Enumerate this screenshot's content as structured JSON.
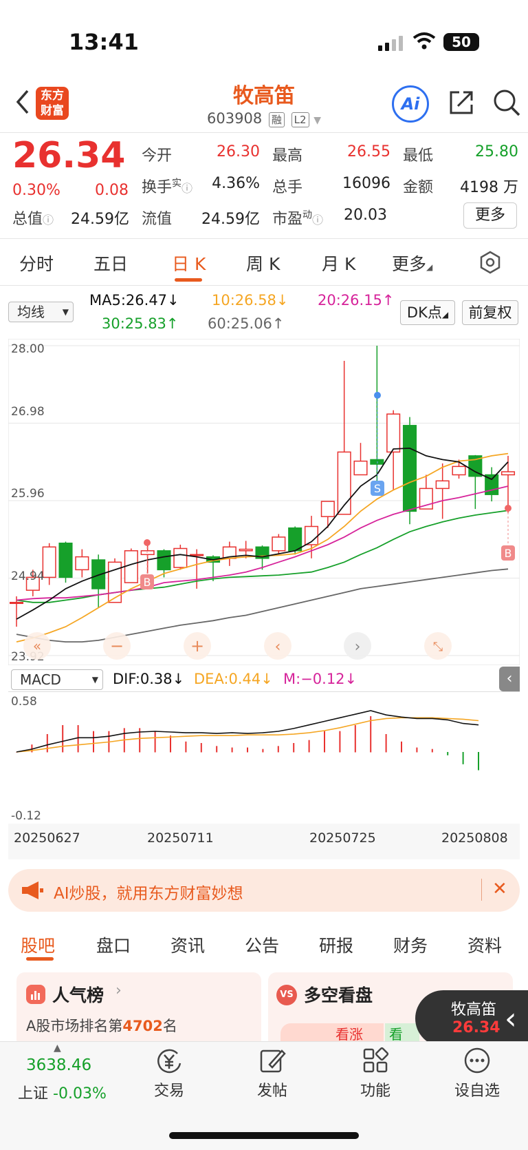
{
  "status": {
    "time": "13:41",
    "battery": "50"
  },
  "header": {
    "logo_line1": "东方",
    "logo_line2": "财富",
    "title": "牧高笛",
    "code": "603908",
    "tag1": "融",
    "tag2": "L2",
    "ai": "Ai"
  },
  "quote": {
    "price": "26.34",
    "pct": "0.30%",
    "change": "0.08",
    "open_label": "今开",
    "open": "26.30",
    "high_label": "最高",
    "high": "26.55",
    "low_label": "最低",
    "low": "25.80",
    "turnover_label": "换手",
    "turnover_sup": "实",
    "turnover": "4.36%",
    "vol_label": "总手",
    "vol": "16096",
    "amount_label": "金额",
    "amount": "4198 万",
    "mcap_label": "总值",
    "mcap": "24.59亿",
    "float_label": "流值",
    "float": "24.59亿",
    "pe_label": "市盈",
    "pe_sup": "动",
    "pe": "20.03",
    "more": "更多"
  },
  "tabs": [
    "分时",
    "五日",
    "日 K",
    "周 K",
    "月 K",
    "更多"
  ],
  "ma": {
    "selector": "均线",
    "ma5": "MA5:26.47↓",
    "ma10": "10:26.58↓",
    "ma20": "20:26.15↑",
    "ma30": "30:25.83↑",
    "ma60": "60:25.06↑",
    "dk": "DK点",
    "fq": "前复权"
  },
  "kchart": {
    "y_labels": [
      "28.00",
      "26.98",
      "25.96",
      "24.94",
      "23.92"
    ],
    "marker_b": "B",
    "marker_s": "S"
  },
  "macd": {
    "selector": "MACD",
    "dif": "DIF:0.38↓",
    "dea": "DEA:0.44↓",
    "m": "M:−0.12↓",
    "y_top": "0.58",
    "y_bottom": "-0.12"
  },
  "dates": [
    "20250627",
    "20250711",
    "20250725",
    "20250808"
  ],
  "banner": {
    "text": "AI炒股，就用东方财富妙想",
    "close": "✕"
  },
  "bottom_tabs": [
    "股吧",
    "盘口",
    "资讯",
    "公告",
    "研报",
    "财务",
    "资料"
  ],
  "cards": {
    "hot_title": "人气榜",
    "hot_sub_prefix": "A股市场排名第",
    "hot_rank": "4702",
    "hot_sub_suffix": "名",
    "ls_title": "多空看盘",
    "ls_badge": "VS",
    "ls_bull": "看涨",
    "ls_bear": "看"
  },
  "float_widget": {
    "name": "牧高笛",
    "price": "26.34"
  },
  "bottom_nav": {
    "index_value": "3638.46",
    "index_name": "上证",
    "index_pct": "-0.03%",
    "trade": "交易",
    "post": "发帖",
    "func": "功能",
    "watch": "设自选"
  },
  "chart_data": [
    {
      "type": "candlestick",
      "title": "",
      "x": [
        "20250627",
        "20250711",
        "20250725",
        "20250808"
      ],
      "ylim": [
        23.92,
        28.0
      ],
      "y_ticks": [
        28.0,
        26.98,
        25.96,
        24.94,
        23.92
      ],
      "colors": {
        "up": "#e8312f",
        "down": "#16a02a",
        "ma5": "#111111",
        "ma10": "#f5a623",
        "ma20": "#d6239a",
        "ma30": "#16a02a",
        "ma60": "#666666"
      },
      "candles": [
        {
          "o": 24.62,
          "c": 24.62,
          "h": 24.7,
          "l": 24.3
        },
        {
          "o": 24.78,
          "c": 24.95,
          "h": 25.05,
          "l": 24.7
        },
        {
          "o": 24.95,
          "c": 25.35,
          "h": 25.4,
          "l": 24.85
        },
        {
          "o": 25.4,
          "c": 24.95,
          "h": 25.42,
          "l": 24.88
        },
        {
          "o": 25.05,
          "c": 25.22,
          "h": 25.32,
          "l": 24.95
        },
        {
          "o": 25.18,
          "c": 24.8,
          "h": 25.25,
          "l": 24.55
        },
        {
          "o": 24.62,
          "c": 25.15,
          "h": 25.2,
          "l": 24.62
        },
        {
          "o": 24.88,
          "c": 25.3,
          "h": 25.33,
          "l": 24.88
        },
        {
          "o": 25.25,
          "c": 25.3,
          "h": 25.44,
          "l": 25.0
        },
        {
          "o": 25.3,
          "c": 25.05,
          "h": 25.32,
          "l": 24.95
        },
        {
          "o": 25.08,
          "c": 25.33,
          "h": 25.38,
          "l": 25.05
        },
        {
          "o": 25.25,
          "c": 25.25,
          "h": 25.32,
          "l": 24.8
        },
        {
          "o": 25.22,
          "c": 25.15,
          "h": 25.24,
          "l": 24.9
        },
        {
          "o": 25.2,
          "c": 25.35,
          "h": 25.42,
          "l": 25.1
        },
        {
          "o": 25.3,
          "c": 25.32,
          "h": 25.43,
          "l": 25.2
        },
        {
          "o": 25.35,
          "c": 25.2,
          "h": 25.37,
          "l": 25.05
        },
        {
          "o": 25.3,
          "c": 25.48,
          "h": 25.52,
          "l": 25.25
        },
        {
          "o": 25.6,
          "c": 25.3,
          "h": 25.62,
          "l": 25.25
        },
        {
          "o": 25.38,
          "c": 25.62,
          "h": 25.76,
          "l": 25.2
        },
        {
          "o": 25.75,
          "c": 25.95,
          "h": 25.95,
          "l": 25.6
        },
        {
          "o": 25.78,
          "c": 26.6,
          "h": 27.8,
          "l": 25.78
        },
        {
          "o": 26.3,
          "c": 26.48,
          "h": 26.72,
          "l": 26.3
        },
        {
          "o": 26.5,
          "c": 26.44,
          "h": 28.0,
          "l": 26.2
        },
        {
          "o": 26.6,
          "c": 27.1,
          "h": 27.15,
          "l": 26.1
        },
        {
          "o": 26.95,
          "c": 25.82,
          "h": 27.06,
          "l": 25.65
        },
        {
          "o": 25.85,
          "c": 26.12,
          "h": 26.3,
          "l": 25.85
        },
        {
          "o": 26.12,
          "c": 26.22,
          "h": 26.45,
          "l": 25.72
        },
        {
          "o": 26.3,
          "c": 26.41,
          "h": 26.5,
          "l": 26.25
        },
        {
          "o": 26.55,
          "c": 26.28,
          "h": 26.56,
          "l": 25.85
        },
        {
          "o": 26.3,
          "c": 26.04,
          "h": 26.4,
          "l": 25.95
        },
        {
          "o": 26.3,
          "c": 26.34,
          "h": 26.55,
          "l": 25.8
        }
      ],
      "ma5": [
        24.4,
        24.52,
        24.65,
        24.8,
        24.9,
        24.98,
        25.05,
        25.12,
        25.18,
        25.22,
        25.25,
        25.22,
        25.18,
        25.22,
        25.24,
        25.22,
        25.26,
        25.3,
        25.42,
        25.62,
        25.9,
        26.15,
        26.3,
        26.64,
        26.65,
        26.55,
        26.5,
        26.47,
        26.34,
        26.24,
        26.47
      ],
      "ma10": [
        24.1,
        24.15,
        24.22,
        24.3,
        24.42,
        24.55,
        24.68,
        24.8,
        24.9,
        25.0,
        25.06,
        25.12,
        25.17,
        25.2,
        25.22,
        25.23,
        25.24,
        25.26,
        25.33,
        25.45,
        25.62,
        25.82,
        25.98,
        26.1,
        26.2,
        26.28,
        26.4,
        26.48,
        26.5,
        26.55,
        26.58
      ],
      "ma20": [
        24.65,
        24.67,
        24.68,
        24.68,
        24.7,
        24.72,
        24.75,
        24.78,
        24.82,
        24.88,
        24.9,
        24.92,
        24.95,
        24.98,
        25.02,
        25.08,
        25.15,
        25.22,
        25.3,
        25.38,
        25.48,
        25.6,
        25.7,
        25.78,
        25.84,
        25.9,
        25.96,
        26.0,
        26.05,
        26.1,
        26.15
      ],
      "ma30": [
        24.65,
        24.62,
        24.62,
        24.65,
        24.68,
        24.72,
        24.75,
        24.78,
        24.8,
        24.82,
        24.86,
        24.9,
        24.93,
        24.95,
        24.96,
        24.97,
        24.98,
        25.0,
        25.02,
        25.08,
        25.15,
        25.25,
        25.34,
        25.45,
        25.55,
        25.62,
        25.68,
        25.73,
        25.77,
        25.8,
        25.83
      ],
      "ma60": [
        24.2,
        24.16,
        24.12,
        24.1,
        24.1,
        24.12,
        24.16,
        24.2,
        24.24,
        24.28,
        24.32,
        24.35,
        24.38,
        24.42,
        24.45,
        24.5,
        24.55,
        24.6,
        24.65,
        24.7,
        24.75,
        24.8,
        24.83,
        24.86,
        24.89,
        24.92,
        24.95,
        24.98,
        25.01,
        25.04,
        25.06
      ]
    },
    {
      "type": "bar",
      "title": "MACD",
      "ylim": [
        -0.12,
        0.58
      ],
      "macd_hist": [
        0.0,
        0.05,
        0.12,
        0.18,
        0.18,
        0.14,
        0.14,
        0.16,
        0.16,
        0.14,
        0.11,
        0.07,
        0.06,
        0.04,
        0.03,
        0.03,
        0.02,
        0.04,
        0.06,
        0.08,
        0.14,
        0.14,
        0.18,
        0.24,
        0.12,
        0.07,
        0.03,
        0.02,
        -0.02,
        -0.08,
        -0.12
      ],
      "dif": [
        0.0,
        0.04,
        0.1,
        0.15,
        0.2,
        0.2,
        0.22,
        0.26,
        0.28,
        0.29,
        0.28,
        0.27,
        0.27,
        0.26,
        0.27,
        0.26,
        0.27,
        0.29,
        0.33,
        0.38,
        0.43,
        0.48,
        0.53,
        0.58,
        0.52,
        0.49,
        0.47,
        0.47,
        0.45,
        0.4,
        0.38
      ],
      "dea": [
        0.0,
        0.02,
        0.05,
        0.08,
        0.1,
        0.12,
        0.14,
        0.17,
        0.19,
        0.2,
        0.21,
        0.22,
        0.23,
        0.23,
        0.23,
        0.24,
        0.24,
        0.24,
        0.25,
        0.27,
        0.3,
        0.34,
        0.39,
        0.44,
        0.47,
        0.48,
        0.48,
        0.48,
        0.47,
        0.46,
        0.44
      ]
    }
  ]
}
